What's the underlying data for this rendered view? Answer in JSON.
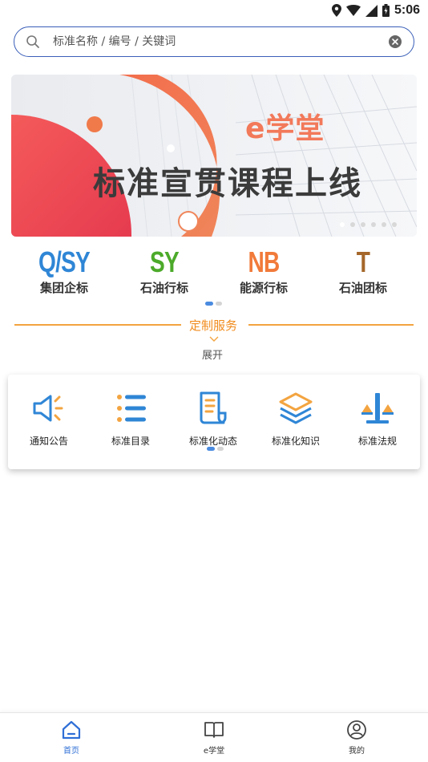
{
  "status_bar": {
    "time": "5:06"
  },
  "search": {
    "placeholder": "标准名称 / 编号 / 关键词"
  },
  "banner": {
    "brand": "e学堂",
    "title": "标准宣贯课程上线",
    "slides": 6,
    "active_slide": 1
  },
  "categories": [
    {
      "code": "Q/SY",
      "label": "集团企标",
      "color": "#2f86d6"
    },
    {
      "code": "SY",
      "label": "石油行标",
      "color": "#4caa2a"
    },
    {
      "code": "NB",
      "label": "能源行标",
      "color": "#f17a3a"
    },
    {
      "code": "T",
      "label": "石油团标",
      "color": "#a5672a"
    }
  ],
  "service": {
    "title": "定制服务",
    "expand": "展开"
  },
  "functions": [
    {
      "label": "通知公告",
      "icon": "megaphone-icon"
    },
    {
      "label": "标准目录",
      "icon": "list-icon"
    },
    {
      "label": "标准化动态",
      "icon": "document-icon"
    },
    {
      "label": "标准化知识",
      "icon": "layers-icon"
    },
    {
      "label": "标准法规",
      "icon": "scale-icon"
    }
  ],
  "bottom_nav": [
    {
      "label": "首页",
      "icon": "home-icon",
      "active": true
    },
    {
      "label": "e学堂",
      "icon": "book-icon",
      "active": false
    },
    {
      "label": "我的",
      "icon": "user-icon",
      "active": false
    }
  ],
  "colors": {
    "accent": "#2f6fd6",
    "orange": "#f18b1c"
  }
}
